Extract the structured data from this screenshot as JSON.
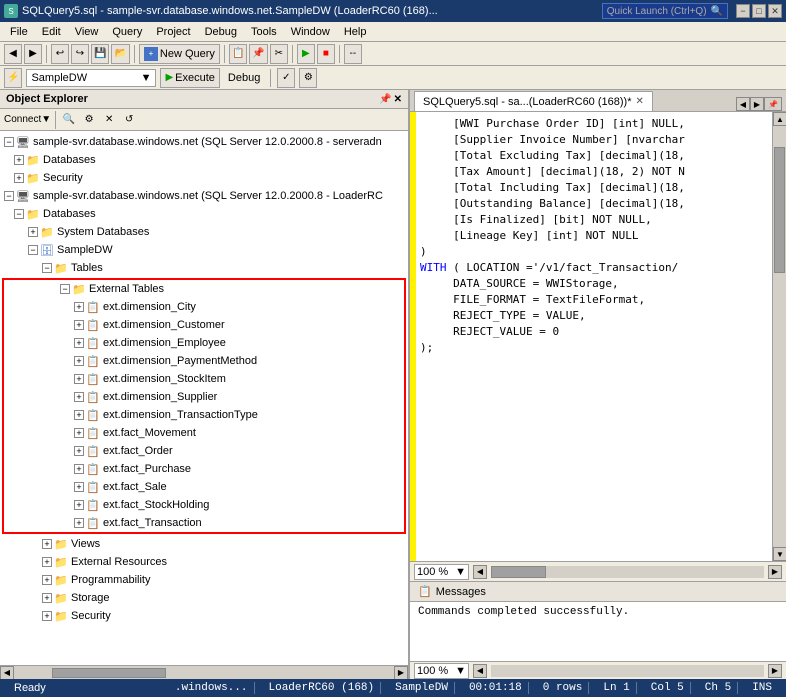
{
  "titlebar": {
    "title": "SQLQuery5.sql - sample-svr.database.windows.net.SampleDW (LoaderRC60 (168)...",
    "quicklaunch": "Quick Launch (Ctrl+Q)"
  },
  "menu": {
    "items": [
      "File",
      "Edit",
      "View",
      "Query",
      "Project",
      "Debug",
      "Tools",
      "Window",
      "Help"
    ]
  },
  "toolbar1": {
    "new_query_label": "New Query"
  },
  "toolbar2": {
    "database": "SampleDW",
    "execute_label": "Execute",
    "debug_label": "Debug"
  },
  "object_explorer": {
    "title": "Object Explorer",
    "connect_label": "Connect",
    "servers": [
      {
        "name": "sample-svr.database.windows.net (SQL Server 12.0.2000.8 - serveradn",
        "expanded": true,
        "children": [
          {
            "name": "Databases",
            "type": "folder",
            "expanded": false
          },
          {
            "name": "Security",
            "type": "folder",
            "expanded": false
          }
        ]
      },
      {
        "name": "sample-svr.database.windows.net (SQL Server 12.0.2000.8 - LoaderRC",
        "expanded": true,
        "children": [
          {
            "name": "Databases",
            "type": "folder",
            "expanded": true,
            "children": [
              {
                "name": "System Databases",
                "type": "folder",
                "expanded": false
              },
              {
                "name": "SampleDW",
                "type": "database",
                "expanded": true,
                "children": [
                  {
                    "name": "Tables",
                    "type": "folder",
                    "expanded": true,
                    "children": [
                      {
                        "name": "External Tables",
                        "type": "folder",
                        "expanded": true,
                        "highlighted": true,
                        "children": [
                          {
                            "name": "ext.dimension_City",
                            "type": "table"
                          },
                          {
                            "name": "ext.dimension_Customer",
                            "type": "table"
                          },
                          {
                            "name": "ext.dimension_Employee",
                            "type": "table"
                          },
                          {
                            "name": "ext.dimension_PaymentMethod",
                            "type": "table"
                          },
                          {
                            "name": "ext.dimension_StockItem",
                            "type": "table"
                          },
                          {
                            "name": "ext.dimension_Supplier",
                            "type": "table"
                          },
                          {
                            "name": "ext.dimension_TransactionType",
                            "type": "table"
                          },
                          {
                            "name": "ext.fact_Movement",
                            "type": "table"
                          },
                          {
                            "name": "ext.fact_Order",
                            "type": "table"
                          },
                          {
                            "name": "ext.fact_Purchase",
                            "type": "table"
                          },
                          {
                            "name": "ext.fact_Sale",
                            "type": "table"
                          },
                          {
                            "name": "ext.fact_StockHolding",
                            "type": "table"
                          },
                          {
                            "name": "ext.fact_Transaction",
                            "type": "table"
                          }
                        ]
                      }
                    ]
                  },
                  {
                    "name": "Views",
                    "type": "folder",
                    "expanded": false
                  },
                  {
                    "name": "External Resources",
                    "type": "folder",
                    "expanded": false
                  },
                  {
                    "name": "Programmability",
                    "type": "folder",
                    "expanded": false
                  },
                  {
                    "name": "Storage",
                    "type": "folder",
                    "expanded": false
                  },
                  {
                    "name": "Security",
                    "type": "folder",
                    "expanded": false
                  }
                ]
              }
            ]
          }
        ]
      }
    ]
  },
  "query_editor": {
    "tab_label": "SQLQuery5.sql - sa...(LoaderRC60 (168))*",
    "code": "     [WWI Purchase Order ID] [int] NULL,\n     [Supplier Invoice Number] [nvarchar\n     [Total Excluding Tax] [decimal](18,\n     [Tax Amount] [decimal](18, 2) NOT N\n     [Total Including Tax] [decimal](18,\n     [Outstanding Balance] [decimal](18,\n     [Is Finalized] [bit] NOT NULL,\n     [Lineage Key] [int] NOT NULL\n)\nWITH ( LOCATION ='/v1/fact_Transaction/\n     DATA_SOURCE = WWIStorage,\n     FILE_FORMAT = TextFileFormat,\n     REJECT_TYPE = VALUE,\n     REJECT_VALUE = 0\n);",
    "zoom": "100 %"
  },
  "messages": {
    "tab_label": "Messages",
    "content": "Commands completed successfully.",
    "zoom": "100 %"
  },
  "statusbar": {
    "ready": "Ready",
    "server": ".windows...",
    "loader": "LoaderRC60 (168)",
    "database": "SampleDW",
    "time": "00:01:18",
    "rows": "0 rows",
    "ln": "Ln 1",
    "col": "Col 5",
    "ch": "Ch 5",
    "ins": "INS"
  }
}
